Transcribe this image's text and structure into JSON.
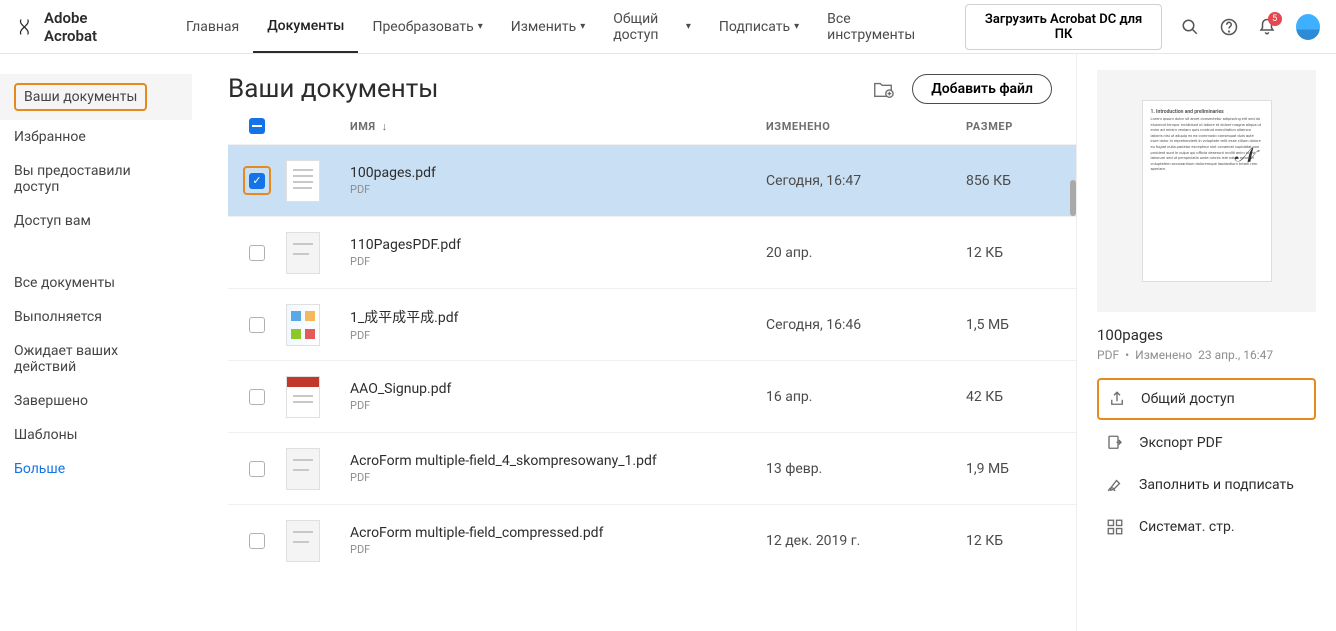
{
  "header": {
    "app_name": "Adobe Acrobat",
    "nav": [
      "Главная",
      "Документы",
      "Преобразовать",
      "Изменить",
      "Общий доступ",
      "Подписать",
      "Все инструменты"
    ],
    "download_label": "Загрузить Acrobat DC для ПК",
    "notification_count": "5"
  },
  "sidebar": {
    "group1": [
      "Ваши документы",
      "Избранное",
      "Вы предоставили доступ",
      "Доступ вам"
    ],
    "group2": [
      "Все документы",
      "Выполняется",
      "Ожидает ваших действий",
      "Завершено",
      "Шаблоны"
    ],
    "more_label": "Больше"
  },
  "main": {
    "title": "Ваши документы",
    "add_file_label": "Добавить файл",
    "columns": {
      "name": "ИМЯ",
      "modified": "ИЗМЕНЕНО",
      "size": "РАЗМЕР"
    },
    "rows": [
      {
        "name": "100pages.pdf",
        "type": "PDF",
        "modified": "Сегодня, 16:47",
        "size": "856 КБ",
        "selected": true
      },
      {
        "name": "110PagesPDF.pdf",
        "type": "PDF",
        "modified": "20 апр.",
        "size": "12 КБ",
        "selected": false
      },
      {
        "name": "1_成平成平成.pdf",
        "type": "PDF",
        "modified": "Сегодня, 16:46",
        "size": "1,5 МБ",
        "selected": false
      },
      {
        "name": "AAO_Signup.pdf",
        "type": "PDF",
        "modified": "16 апр.",
        "size": "42 КБ",
        "selected": false
      },
      {
        "name": "AcroForm multiple-field_4_skompresowany_1.pdf",
        "type": "PDF",
        "modified": "13 февр.",
        "size": "1,9 МБ",
        "selected": false
      },
      {
        "name": "AcroForm multiple-field_compressed.pdf",
        "type": "PDF",
        "modified": "12 дек. 2019 г.",
        "size": "12 КБ",
        "selected": false
      }
    ]
  },
  "details": {
    "title": "100pages",
    "type_label": "PDF",
    "mod_prefix": "Изменено",
    "mod_value": "23 апр., 16:47",
    "actions": [
      "Общий доступ",
      "Экспорт PDF",
      "Заполнить и подписать",
      "Системат. стр."
    ]
  }
}
